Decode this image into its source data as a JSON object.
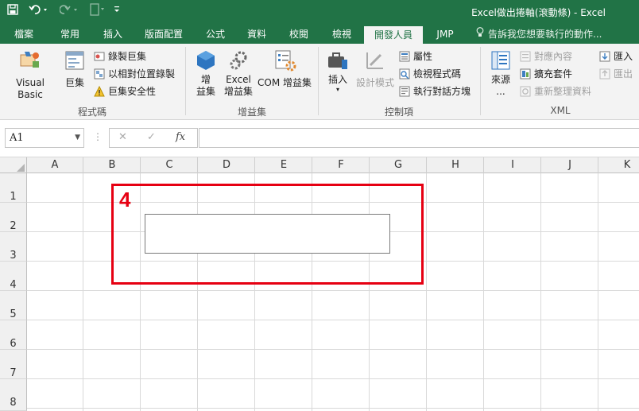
{
  "window": {
    "title": "Excel做出捲軸(滾動條) - Excel"
  },
  "qat": {
    "save_icon": "save-icon",
    "undo_icon": "undo-icon",
    "redo_icon": "redo-icon",
    "customize_icon": "customize-qat-icon"
  },
  "tabs": [
    "檔案",
    "常用",
    "插入",
    "版面配置",
    "公式",
    "資料",
    "校閱",
    "檢視",
    "開發人員",
    "JMP"
  ],
  "active_tab": "開發人員",
  "tell_me": "告訴我您想要執行的動作...",
  "ribbon": {
    "code_group": {
      "label": "程式碼",
      "visual_basic": "Visual Basic",
      "macros": "巨集",
      "record_macro": "錄製巨集",
      "relative_ref": "以相對位置錄製",
      "macro_security": "巨集安全性"
    },
    "addins_group": {
      "label": "增益集",
      "addins": [
        "增",
        "益集"
      ],
      "excel_addins": [
        "Excel",
        "增益集"
      ],
      "com_addins": "COM 增益集"
    },
    "controls_group": {
      "label": "控制項",
      "insert": "插入",
      "design_mode": "設計模式",
      "properties": "屬性",
      "view_code": "檢視程式碼",
      "run_dialog": "執行對話方塊"
    },
    "xml_group": {
      "label": "XML",
      "source": [
        "來源",
        "..."
      ],
      "map_properties": "對應內容",
      "expansion_packs": "擴充套件",
      "refresh_data": "重新整理資料",
      "import": "匯入",
      "export": "匯出"
    }
  },
  "formula_bar": {
    "name_box": "A1",
    "cancel": "✕",
    "enter": "✓",
    "fx": "fx",
    "formula": ""
  },
  "grid": {
    "columns": [
      "A",
      "B",
      "C",
      "D",
      "E",
      "F",
      "G",
      "H",
      "I",
      "J",
      "K"
    ],
    "rows": [
      "1",
      "2",
      "3",
      "4",
      "5",
      "6",
      "7",
      "8"
    ]
  },
  "annotation": {
    "number": "4"
  },
  "colors": {
    "brand": "#217346",
    "annotation": "#e60012"
  }
}
